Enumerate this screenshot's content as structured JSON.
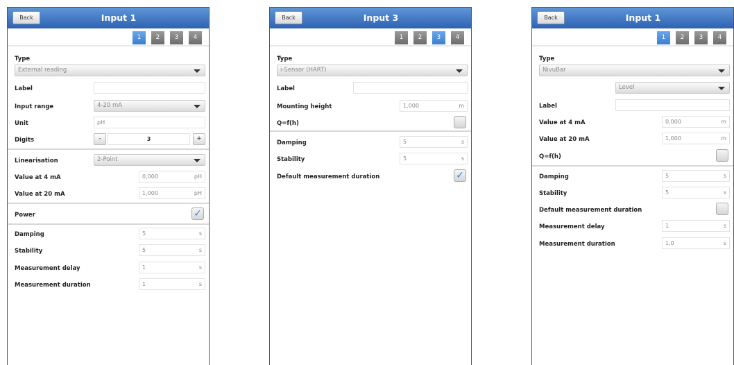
{
  "panel1": {
    "back": "Back",
    "title": "Input 1",
    "tabs": [
      "1",
      "2",
      "3",
      "4"
    ],
    "active_tab": "1",
    "type_label": "Type",
    "type_value": "External reading",
    "label_label": "Label",
    "label_value": "",
    "input_range_label": "Input range",
    "input_range_value": "4-20 mA",
    "unit_label": "Unit",
    "unit_value": "pH",
    "digits_label": "Digits",
    "digits_minus": "-",
    "digits_value": "3",
    "digits_plus": "+",
    "linearisation_label": "Linearisation",
    "linearisation_value": "2-Point",
    "v4_label": "Value at 4 mA",
    "v4_value": "0,000",
    "v4_unit": "pH",
    "v20_label": "Value at 20 mA",
    "v20_value": "1,000",
    "v20_unit": "pH",
    "power_label": "Power",
    "power_checked": "✓",
    "damping_label": "Damping",
    "damping_value": "5",
    "damping_unit": "s",
    "stability_label": "Stability",
    "stability_value": "5",
    "stability_unit": "s",
    "delay_label": "Measurement delay",
    "delay_value": "1",
    "delay_unit": "s",
    "duration_label": "Measurement duration",
    "duration_value": "1",
    "duration_unit": "s"
  },
  "panel2": {
    "back": "Back",
    "title": "Input 3",
    "tabs": [
      "1",
      "2",
      "3",
      "4"
    ],
    "active_tab": "3",
    "type_label": "Type",
    "type_value": "i-Sensor (HART)",
    "label_label": "Label",
    "label_value": "",
    "mount_label": "Mounting height",
    "mount_value": "1,000",
    "mount_unit": "m",
    "qfh_label": "Q=f(h)",
    "qfh_checked": "",
    "damping_label": "Damping",
    "damping_value": "5",
    "damping_unit": "s",
    "stability_label": "Stability",
    "stability_value": "5",
    "stability_unit": "s",
    "default_dur_label": "Default measurement duration",
    "default_dur_checked": "✓"
  },
  "panel3": {
    "back": "Back",
    "title": "Input 1",
    "tabs": [
      "1",
      "2",
      "3",
      "4"
    ],
    "active_tab": "1",
    "type_label": "Type",
    "type_value": "NivuBar",
    "level_value": "Level",
    "label_label": "Label",
    "label_value": "",
    "v4_label": "Value at 4 mA",
    "v4_value": "0,000",
    "v4_unit": "m",
    "v20_label": "Value at 20 mA",
    "v20_value": "1,000",
    "v20_unit": "m",
    "qfh_label": "Q=f(h)",
    "qfh_checked": "",
    "damping_label": "Damping",
    "damping_value": "5",
    "damping_unit": "s",
    "stability_label": "Stability",
    "stability_value": "5",
    "stability_unit": "s",
    "default_dur_label": "Default measurement duration",
    "default_dur_checked": "",
    "delay_label": "Measurement delay",
    "delay_value": "1",
    "delay_unit": "s",
    "duration_label": "Measurement duration",
    "duration_value": "1,0",
    "duration_unit": "s"
  }
}
